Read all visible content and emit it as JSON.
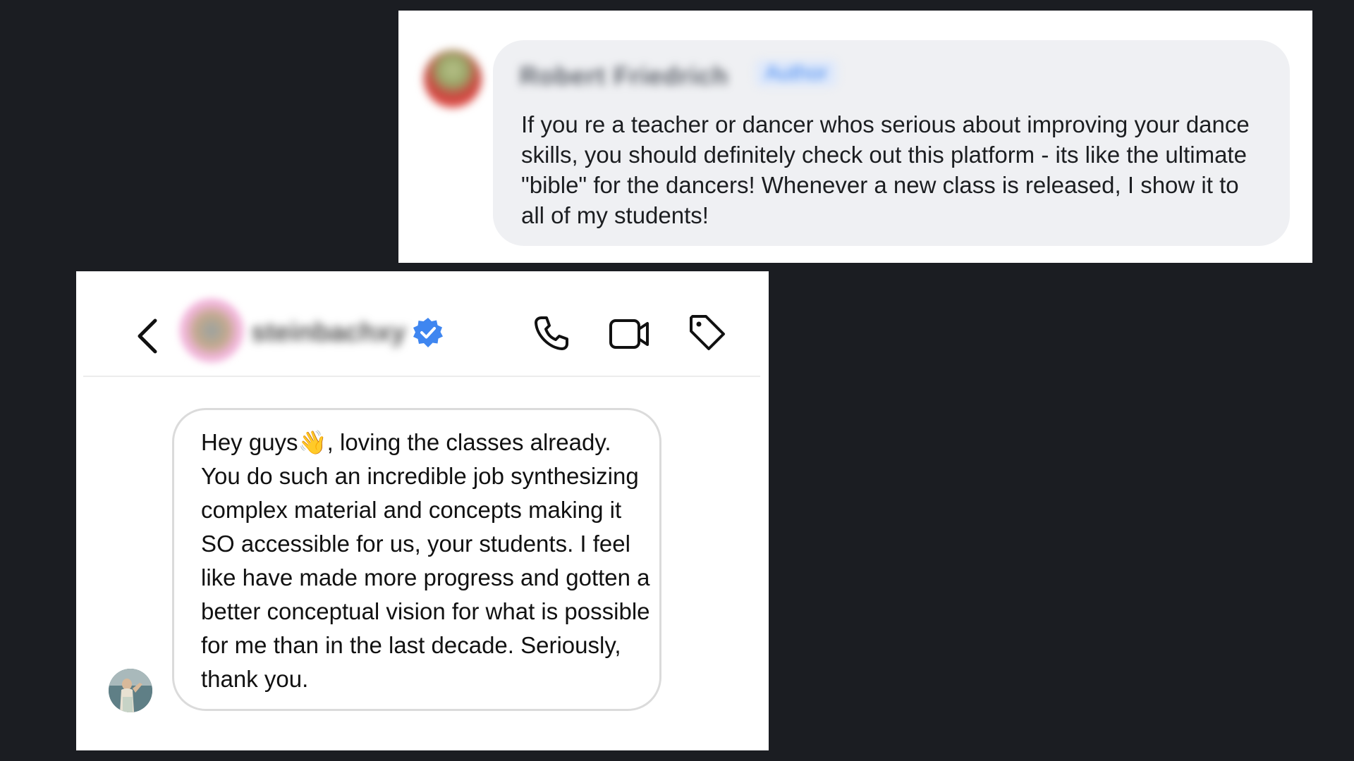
{
  "comment_card": {
    "author_name": "Robert Friedrich",
    "author_badge": "Author",
    "text": "If you re a teacher or dancer whos serious about improving your dance skills, you should definitely check out this platform - its like the ultimate \"bible\" for the dancers! Whenever a new class is released, I show it to all of my students!"
  },
  "dm_card": {
    "header": {
      "username": "steinbachxy",
      "verified": true,
      "icons": [
        "back-icon",
        "verified-icon",
        "phone-icon",
        "video-camera-icon",
        "tag-icon"
      ]
    },
    "message": {
      "text": "Hey guys👋, loving the classes already. You do such an incredible job synthesizing complex material and concepts making it SO accessible for us, your students. I feel like have made more progress and gotten a better conceptual vision for what is possible for me than in the last decade. Seriously, thank you."
    }
  },
  "colors": {
    "background": "#1b1d22",
    "bubble_gray": "#eff0f3",
    "verified_blue": "#3f86f0"
  }
}
